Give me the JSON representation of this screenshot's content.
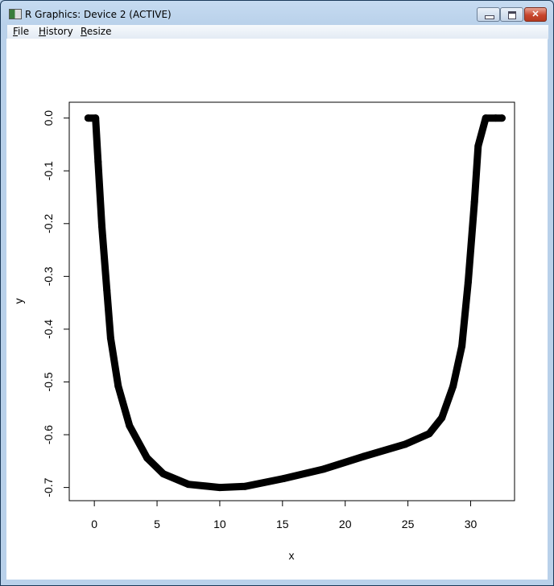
{
  "window": {
    "title": "R Graphics: Device 2 (ACTIVE)",
    "controls": {
      "minimize": "minimize",
      "maximize": "maximize",
      "close": "close"
    }
  },
  "menu": {
    "items": [
      {
        "label": "File",
        "accel": "F",
        "rest": "ile"
      },
      {
        "label": "History",
        "accel": "H",
        "rest": "istory"
      },
      {
        "label": "Resize",
        "accel": "R",
        "rest": "esize"
      }
    ]
  },
  "chart_data": {
    "type": "scatter",
    "title": "",
    "xlabel": "x",
    "ylabel": "y",
    "xlim": [
      -2.0,
      33.5
    ],
    "ylim": [
      -0.725,
      0.03
    ],
    "xticks": [
      0,
      5,
      10,
      15,
      20,
      25,
      30
    ],
    "xtick_labels": [
      "0",
      "5",
      "10",
      "15",
      "20",
      "25",
      "30"
    ],
    "yticks": [
      0.0,
      -0.1,
      -0.2,
      -0.3,
      -0.4,
      -0.5,
      -0.6,
      -0.7
    ],
    "ytick_labels": [
      "0.0",
      "-0.1",
      "-0.2",
      "-0.3",
      "-0.4",
      "-0.5",
      "-0.6",
      "-0.7"
    ],
    "grid": false,
    "series": [
      {
        "name": "y",
        "color": "#000000",
        "x": [
          -0.5,
          0.1,
          0.3,
          0.6,
          1.0,
          1.3,
          1.9,
          2.8,
          4.2,
          5.5,
          7.5,
          10.0,
          12.0,
          15.1,
          18.3,
          21.5,
          24.8,
          26.7,
          27.7,
          28.6,
          29.3,
          29.8,
          30.3,
          30.6,
          31.2,
          32.0,
          32.5
        ],
        "y": [
          0.0,
          0.0,
          -0.083,
          -0.205,
          -0.326,
          -0.417,
          -0.508,
          -0.583,
          -0.644,
          -0.674,
          -0.694,
          -0.7,
          -0.698,
          -0.683,
          -0.665,
          -0.641,
          -0.618,
          -0.598,
          -0.568,
          -0.508,
          -0.432,
          -0.311,
          -0.159,
          -0.053,
          0.0,
          0.0,
          0.0
        ]
      }
    ]
  }
}
